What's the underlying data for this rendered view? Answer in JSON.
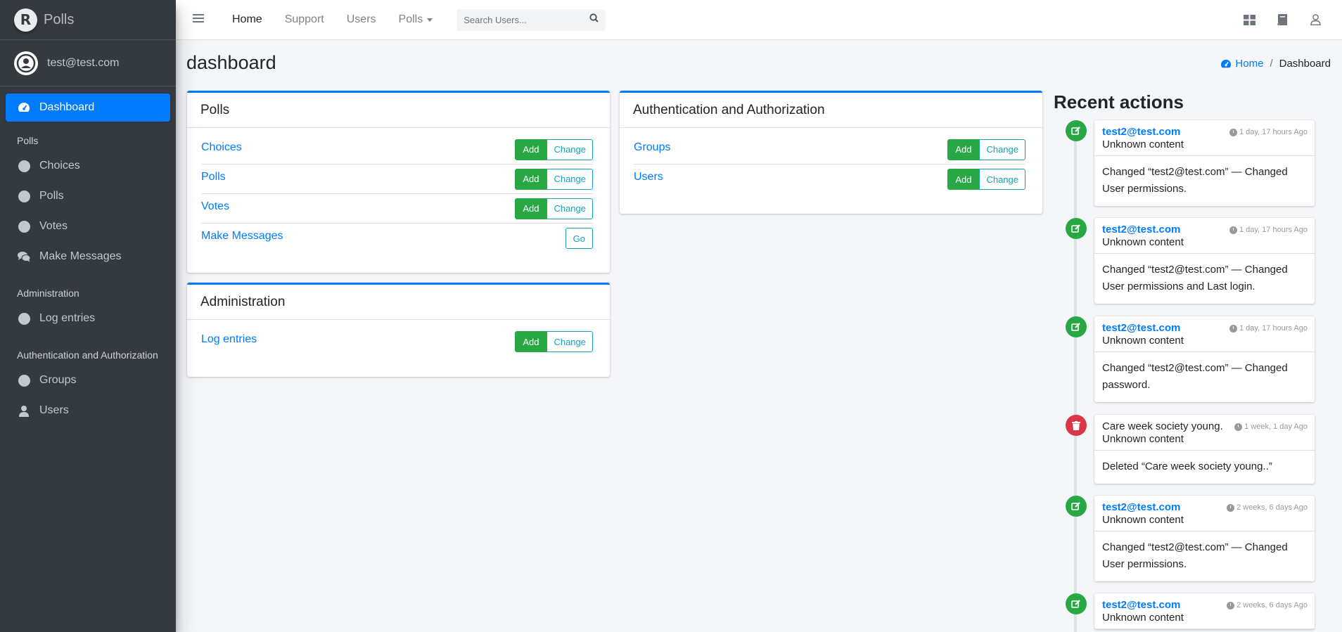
{
  "brand": {
    "name": "Polls",
    "logo_letter": "R"
  },
  "user": {
    "email": "test@test.com"
  },
  "sidebar": {
    "dashboard": "Dashboard",
    "groups": [
      {
        "header": "Polls",
        "items": [
          {
            "label": "Choices",
            "icon": "circle-icon"
          },
          {
            "label": "Polls",
            "icon": "circle-icon"
          },
          {
            "label": "Votes",
            "icon": "circle-icon"
          },
          {
            "label": "Make Messages",
            "icon": "comments-icon"
          }
        ]
      },
      {
        "header": "Administration",
        "items": [
          {
            "label": "Log entries",
            "icon": "circle-icon"
          }
        ]
      },
      {
        "header": "Authentication and Authorization",
        "items": [
          {
            "label": "Groups",
            "icon": "circle-icon"
          },
          {
            "label": "Users",
            "icon": "user-icon"
          }
        ]
      }
    ]
  },
  "topbar": {
    "home": "Home",
    "support": "Support",
    "users": "Users",
    "polls": "Polls",
    "search_placeholder": "Search Users..."
  },
  "page": {
    "title": "dashboard"
  },
  "breadcrumb": {
    "home": "Home",
    "current": "Dashboard"
  },
  "cards": {
    "polls": {
      "title": "Polls",
      "rows": [
        {
          "label": "Choices",
          "add": "Add",
          "change": "Change"
        },
        {
          "label": "Polls",
          "add": "Add",
          "change": "Change"
        },
        {
          "label": "Votes",
          "add": "Add",
          "change": "Change"
        },
        {
          "label": "Make Messages",
          "go": "Go"
        }
      ]
    },
    "administration": {
      "title": "Administration",
      "rows": [
        {
          "label": "Log entries",
          "add": "Add",
          "change": "Change"
        }
      ]
    },
    "auth": {
      "title": "Authentication and Authorization",
      "rows": [
        {
          "label": "Groups",
          "add": "Add",
          "change": "Change"
        },
        {
          "label": "Users",
          "add": "Add",
          "change": "Change"
        }
      ]
    }
  },
  "recent": {
    "title": "Recent actions",
    "items": [
      {
        "type": "change",
        "object": "test2@test.com",
        "content": "Unknown content",
        "time": "1 day, 17 hours Ago",
        "message": "Changed “test2@test.com” — Changed User permissions."
      },
      {
        "type": "change",
        "object": "test2@test.com",
        "content": "Unknown content",
        "time": "1 day, 17 hours Ago",
        "message": "Changed “test2@test.com” — Changed User permissions and Last login."
      },
      {
        "type": "change",
        "object": "test2@test.com",
        "content": "Unknown content",
        "time": "1 day, 17 hours Ago",
        "message": "Changed “test2@test.com” — Changed password."
      },
      {
        "type": "delete",
        "object": "Care week society young.",
        "content": "Unknown content",
        "time": "1 week, 1 day Ago",
        "message": "Deleted “Care week society young..”"
      },
      {
        "type": "change",
        "object": "test2@test.com",
        "content": "Unknown content",
        "time": "2 weeks, 6 days Ago",
        "message": "Changed “test2@test.com” — Changed User permissions."
      },
      {
        "type": "change",
        "object": "test2@test.com",
        "content": "Unknown content",
        "time": "2 weeks, 6 days Ago",
        "message": ""
      }
    ]
  },
  "colors": {
    "primary": "#007bff",
    "success": "#28a745",
    "danger": "#dc3545",
    "info": "#17a2b8",
    "sidebar": "#343a40"
  }
}
